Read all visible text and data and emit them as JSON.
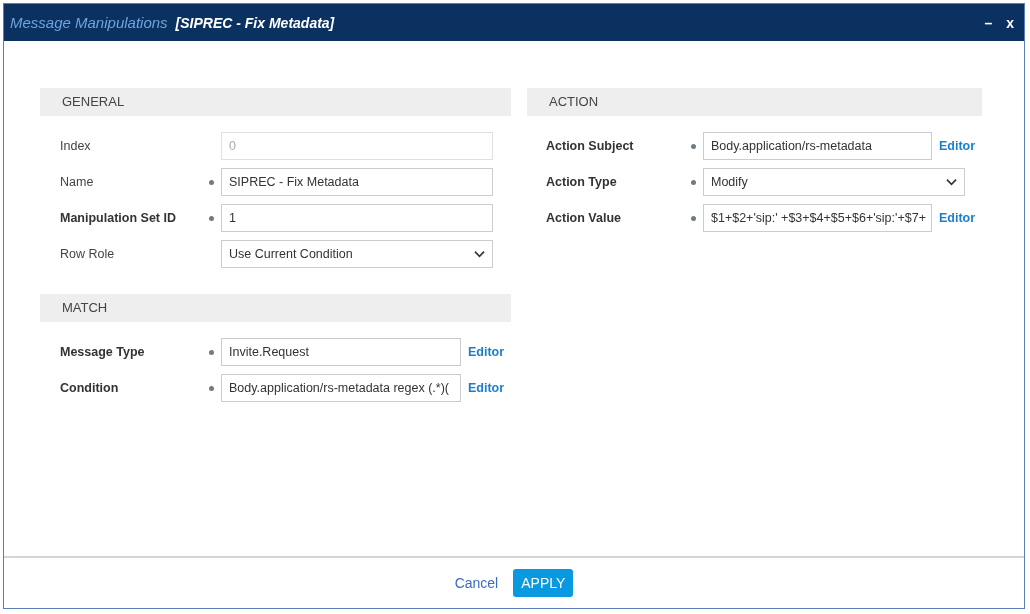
{
  "window": {
    "title": "Message Manipulations",
    "subtitle": "[SIPREC - Fix Metadata]",
    "minimize": "–",
    "close": "x"
  },
  "left_sections": [
    {
      "title": "GENERAL",
      "fields": [
        {
          "label": "Index",
          "bold": false,
          "required": false,
          "kind": "text",
          "value": "0",
          "disabled": true
        },
        {
          "label": "Name",
          "bold": false,
          "required": true,
          "kind": "text",
          "value": "SIPREC - Fix Metadata",
          "disabled": false
        },
        {
          "label": "Manipulation Set ID",
          "bold": true,
          "required": true,
          "kind": "text",
          "value": "1",
          "disabled": false
        },
        {
          "label": "Row Role",
          "bold": false,
          "required": false,
          "kind": "select",
          "value": "Use Current Condition",
          "disabled": false
        }
      ]
    },
    {
      "title": "MATCH",
      "fields": [
        {
          "label": "Message Type",
          "bold": true,
          "required": true,
          "kind": "editor",
          "value": "Invite.Request",
          "link": "Editor",
          "disabled": false
        },
        {
          "label": "Condition",
          "bold": true,
          "required": true,
          "kind": "editor",
          "value": "Body.application/rs-metadata regex (.*)(",
          "link": "Editor",
          "disabled": false
        }
      ]
    }
  ],
  "right_sections": [
    {
      "title": "ACTION",
      "fields": [
        {
          "label": "Action Subject",
          "bold": true,
          "required": true,
          "kind": "editor",
          "value": "Body.application/rs-metadata",
          "link": "Editor",
          "disabled": false
        },
        {
          "label": "Action Type",
          "bold": true,
          "required": true,
          "kind": "select",
          "value": "Modify",
          "disabled": false
        },
        {
          "label": "Action Value",
          "bold": true,
          "required": true,
          "kind": "editor",
          "value": "$1+$2+'sip:' +$3+$4+$5+$6+'sip:'+$7+",
          "link": "Editor",
          "disabled": false
        }
      ]
    }
  ],
  "footer": {
    "cancel": "Cancel",
    "apply": "APPLY"
  }
}
